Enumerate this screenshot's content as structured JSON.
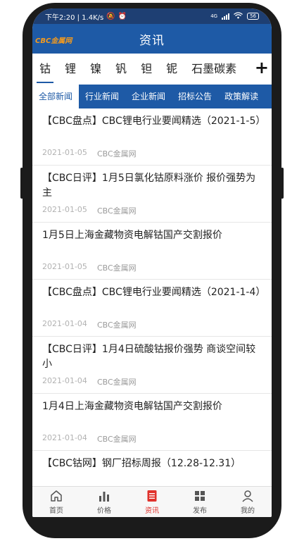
{
  "status_bar": {
    "time_speed": "下午2:20 | 1.4K/s",
    "signal": "4G",
    "battery": "56"
  },
  "header": {
    "brand": "CBC金属网",
    "title": "资讯"
  },
  "metal_tabs": [
    "钴",
    "锂",
    "镍",
    "钒",
    "钽",
    "铌",
    "石墨碳素"
  ],
  "add_tab_label": "+",
  "category_tabs": [
    "全部新闻",
    "行业新闻",
    "企业新闻",
    "招标公告",
    "政策解读"
  ],
  "news": [
    {
      "title": "【CBC盘点】CBC锂电行业要闻精选（2021-1-5）",
      "date": "2021-01-05",
      "source": "CBC金属网"
    },
    {
      "title": "【CBC日评】1月5日氯化钴原料涨价 报价强势为主",
      "date": "2021-01-05",
      "source": "CBC金属网"
    },
    {
      "title": "1月5日上海金藏物资电解钴国产交割报价",
      "date": "2021-01-05",
      "source": "CBC金属网"
    },
    {
      "title": "【CBC盘点】CBC锂电行业要闻精选（2021-1-4）",
      "date": "2021-01-04",
      "source": "CBC金属网"
    },
    {
      "title": "【CBC日评】1月4日硫酸钴报价强势 商谈空间较小",
      "date": "2021-01-04",
      "source": "CBC金属网"
    },
    {
      "title": "1月4日上海金藏物资电解钴国产交割报价",
      "date": "2021-01-04",
      "source": "CBC金属网"
    },
    {
      "title": "【CBC钴网】钢厂招标周报（12.28-12.31）",
      "date": "",
      "source": ""
    }
  ],
  "bottom_nav": [
    {
      "label": "首页",
      "icon": "home-icon"
    },
    {
      "label": "价格",
      "icon": "bar-chart-icon"
    },
    {
      "label": "资讯",
      "icon": "document-icon"
    },
    {
      "label": "发布",
      "icon": "grid-icon"
    },
    {
      "label": "我的",
      "icon": "user-icon"
    }
  ],
  "colors": {
    "primary": "#1e5aa6",
    "status_bar": "#1e3f73",
    "active_nav": "#e0322c",
    "brand": "#f39a1e"
  }
}
